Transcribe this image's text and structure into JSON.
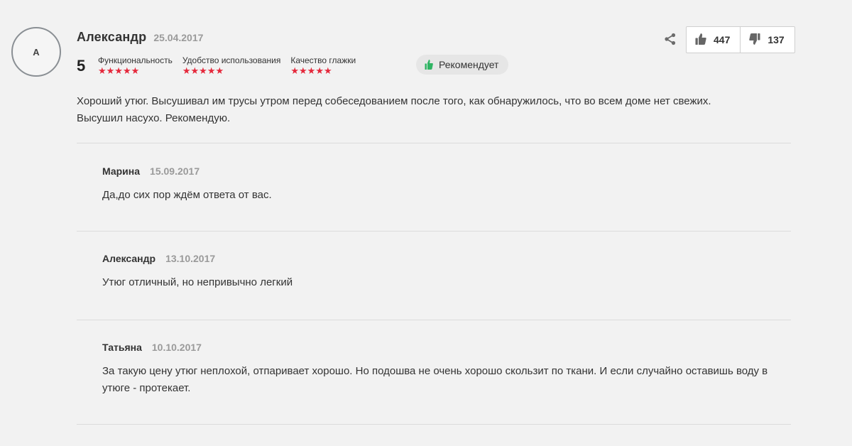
{
  "review": {
    "avatar_initial": "A",
    "author": "Александр",
    "date": "25.04.2017",
    "overall_rating": "5",
    "criteria": [
      {
        "label": "Функциональность",
        "stars": "★★★★★"
      },
      {
        "label": "Удобство использования",
        "stars": "★★★★★"
      },
      {
        "label": "Качество глажки",
        "stars": "★★★★★"
      }
    ],
    "recommend_label": "Рекомендует",
    "likes": "447",
    "dislikes": "137",
    "text": "Хороший утюг. Высушивал им трусы утром перед собеседованием после того, как обнаружилось, что во всем доме нет свежих. Высушил насухо. Рекомендую."
  },
  "replies": [
    {
      "author": "Марина",
      "date": "15.09.2017",
      "text": "Да,до сих пор ждём ответа от вас."
    },
    {
      "author": "Александр",
      "date": "13.10.2017",
      "text": "Утюг отличный, но непривычно легкий"
    },
    {
      "author": "Татьяна",
      "date": "10.10.2017",
      "text": "За такую цену утюг неплохой, отпаривает хорошо. Но подошва не очень хорошо скользит по ткани. И если случайно оставишь воду в утюге - протекает."
    }
  ],
  "icons": {
    "share": "share-icon",
    "like": "thumbs-up-icon",
    "dislike": "thumbs-down-icon",
    "recommend": "thumb-up-green-icon"
  },
  "colors": {
    "stars": "#e5283b",
    "recommend_icon": "#2fb463",
    "background": "#f2f2f2"
  }
}
